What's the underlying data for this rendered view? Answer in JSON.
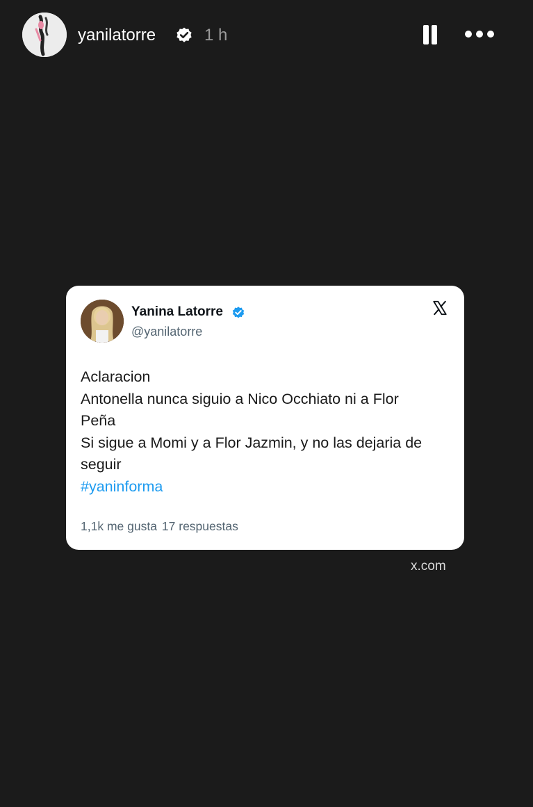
{
  "header": {
    "username": "yanilatorre",
    "time": "1 h",
    "icons": {
      "verified": "verified-badge-icon",
      "pause": "pause-icon",
      "more": "more-options-icon"
    }
  },
  "tweet": {
    "name": "Yanina Latorre",
    "handle": "@yanilatorre",
    "lines": [
      "Aclaracion",
      "Antonella nunca siguio a Nico Occhiato ni a Flor",
      "Peña",
      "Si sigue a Momi y a Flor Jazmin, y no las dejaria de",
      "seguir"
    ],
    "hashtag": "#yaninforma",
    "likes": "1,1k me gusta",
    "replies": "17 respuestas",
    "icons": {
      "verified": "verified-badge-icon",
      "x_logo": "x-logo-icon"
    }
  },
  "source": "x.com",
  "colors": {
    "background": "#1b1b1b",
    "card": "#ffffff",
    "link": "#1d9bf0",
    "verified_blue": "#1d9bf0"
  }
}
